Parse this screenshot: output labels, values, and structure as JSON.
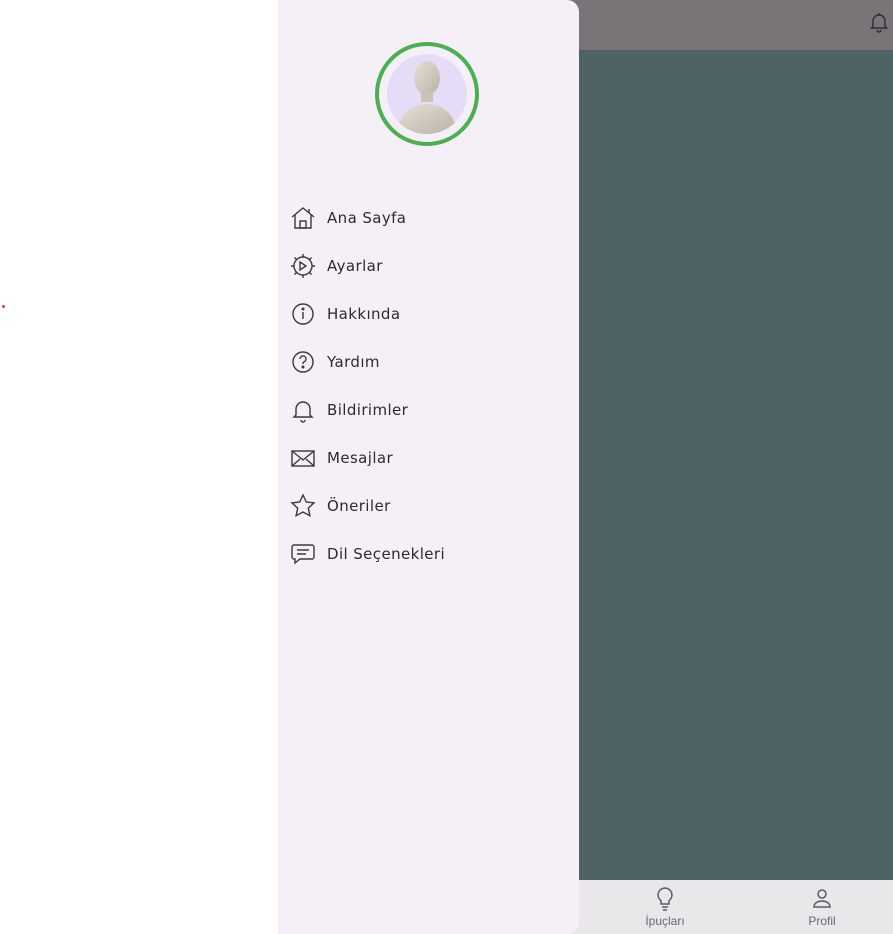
{
  "drawer": {
    "avatar_alt": "profile avatar",
    "items": [
      {
        "label": "Ana Sayfa",
        "icon": "home-icon"
      },
      {
        "label": "Ayarlar",
        "icon": "settings-icon"
      },
      {
        "label": "Hakkında",
        "icon": "info-icon"
      },
      {
        "label": "Yardım",
        "icon": "help-icon"
      },
      {
        "label": "Bildirimler",
        "icon": "bell-icon"
      },
      {
        "label": "Mesajlar",
        "icon": "mail-icon"
      },
      {
        "label": "Öneriler",
        "icon": "star-icon"
      },
      {
        "label": "Dil Seçenekleri",
        "icon": "chat-icon"
      }
    ]
  },
  "bottom_nav": {
    "items": [
      {
        "label": "İpuçları",
        "icon": "lightbulb-icon"
      },
      {
        "label": "Profil",
        "icon": "person-icon"
      }
    ]
  },
  "colors": {
    "drawer_bg": "#f5eff7",
    "avatar_ring": "#4caf50",
    "scrim_content": "#4f6266",
    "appbar": "#7a7479"
  }
}
